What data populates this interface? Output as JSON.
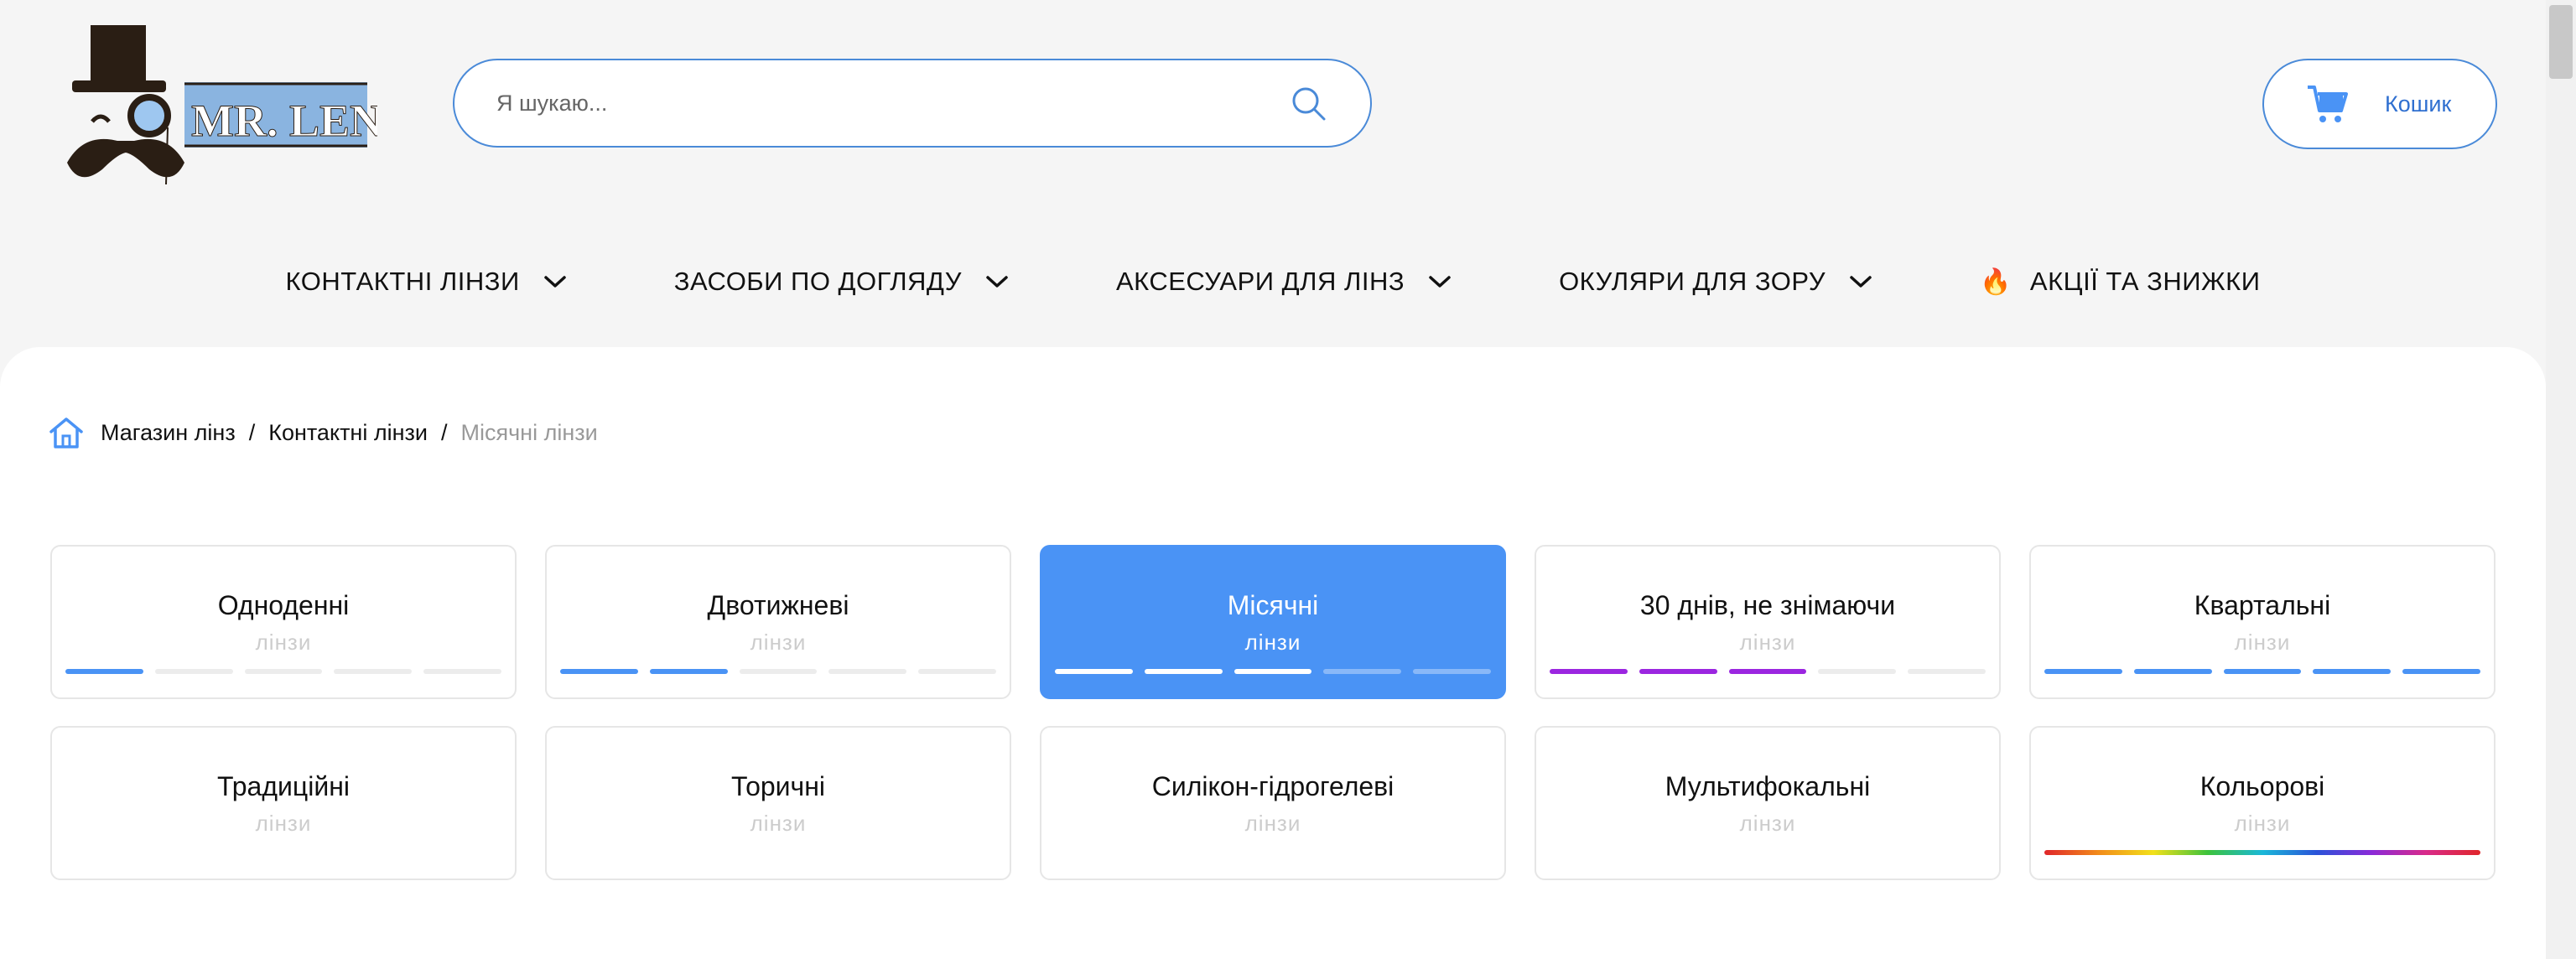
{
  "header": {
    "logo_text": "MR. LENS",
    "search_placeholder": "Я шукаю...",
    "cart_label": "Кошик"
  },
  "nav": {
    "items": [
      {
        "label": "КОНТАКТНІ ЛІНЗИ",
        "has_dropdown": true
      },
      {
        "label": "ЗАСОБИ ПО ДОГЛЯДУ",
        "has_dropdown": true
      },
      {
        "label": "АКСЕСУАРИ ДЛЯ ЛІНЗ",
        "has_dropdown": true
      },
      {
        "label": "ОКУЛЯРИ ДЛЯ ЗОРУ",
        "has_dropdown": true
      },
      {
        "label": "АКЦІЇ ТА ЗНИЖКИ",
        "icon": "fire-icon"
      }
    ]
  },
  "breadcrumb": {
    "items": [
      "Магазин лінз",
      "Контактні лінзи"
    ],
    "current": "Місячні лінзи",
    "separator": "/"
  },
  "categories": [
    {
      "title": "Одноденні",
      "subtitle": "лінзи",
      "indicator": "bars",
      "filled": 1,
      "total": 5,
      "color": "#4a93f5"
    },
    {
      "title": "Двотижневі",
      "subtitle": "лінзи",
      "indicator": "bars",
      "filled": 2,
      "total": 5,
      "color": "#4a93f5"
    },
    {
      "title": "Місячні",
      "subtitle": "лінзи",
      "indicator": "bars",
      "filled": 3,
      "total": 5,
      "color": "#ffffff",
      "active": true
    },
    {
      "title": "30 днів, не знімаючи",
      "subtitle": "лінзи",
      "indicator": "bars",
      "filled": 3,
      "total": 5,
      "color": "#9b26e0"
    },
    {
      "title": "Квартальні",
      "subtitle": "лінзи",
      "indicator": "bars",
      "filled": 5,
      "total": 5,
      "color": "#4a93f5"
    },
    {
      "title": "Традиційні",
      "subtitle": "лінзи",
      "indicator": "none"
    },
    {
      "title": "Торичні",
      "subtitle": "лінзи",
      "indicator": "none"
    },
    {
      "title": "Силікон-гідрогелеві",
      "subtitle": "лінзи",
      "indicator": "none"
    },
    {
      "title": "Мультифокальні",
      "subtitle": "лінзи",
      "indicator": "none"
    },
    {
      "title": "Кольорові",
      "subtitle": "лінзи",
      "indicator": "rainbow"
    }
  ],
  "colors": {
    "accent": "#4a93f5",
    "border_blue": "#4a8ad8",
    "link_blue": "#2f6fd0",
    "purple": "#9b26e0"
  }
}
